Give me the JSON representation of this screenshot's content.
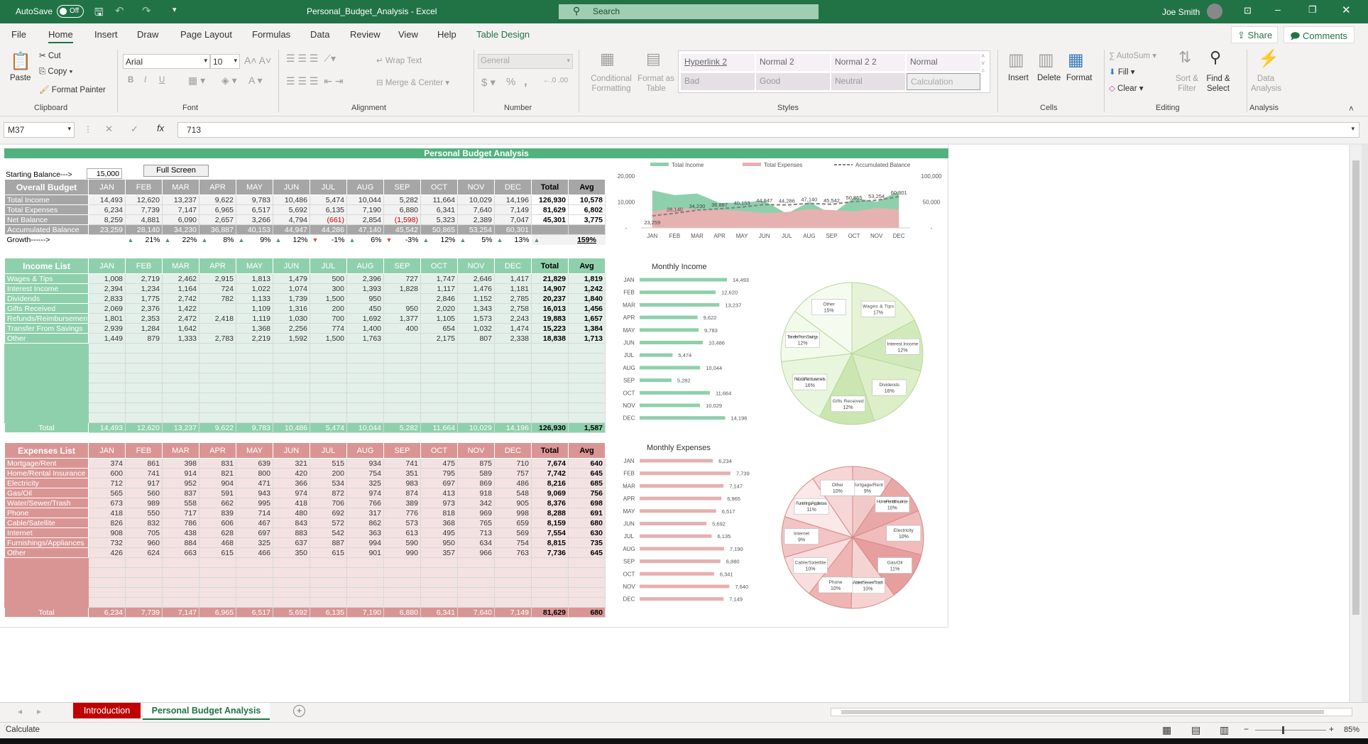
{
  "titlebar": {
    "autosave": "AutoSave",
    "autosave_state": "Off",
    "doc_title": "Personal_Budget_Analysis  -  Excel",
    "search_placeholder": "Search",
    "user": "Joe Smith"
  },
  "menu": {
    "tabs": [
      "File",
      "Home",
      "Insert",
      "Draw",
      "Page Layout",
      "Formulas",
      "Data",
      "Review",
      "View",
      "Help",
      "Table Design"
    ],
    "share": "Share",
    "comments": "Comments"
  },
  "ribbon": {
    "clipboard": {
      "paste": "Paste",
      "cut": "Cut",
      "copy": "Copy",
      "format_painter": "Format Painter",
      "group": "Clipboard"
    },
    "font": {
      "name": "Arial",
      "size": "10",
      "bold": "B",
      "italic": "I",
      "underline": "U",
      "group": "Font"
    },
    "alignment": {
      "wrap": "Wrap Text",
      "merge": "Merge & Center",
      "group": "Alignment"
    },
    "number": {
      "format": "General",
      "currency": "$",
      "percent": "%",
      "comma": ",",
      "group": "Number"
    },
    "styles": {
      "conditional": "Conditional Formatting",
      "format_table": "Format as Table",
      "cells": [
        "Hyperlink 2",
        "Normal 2",
        "Normal 2 2",
        "Normal",
        "Bad",
        "Good",
        "Neutral",
        "Calculation"
      ],
      "group": "Styles"
    },
    "cells": {
      "insert": "Insert",
      "delete": "Delete",
      "format": "Format",
      "group": "Cells"
    },
    "editing": {
      "autosum": "AutoSum",
      "fill": "Fill",
      "clear": "Clear",
      "sort": "Sort & Filter",
      "find": "Find & Select",
      "group": "Editing"
    },
    "analysis": {
      "data_analysis": "Data Analysis",
      "group": "Analysis"
    }
  },
  "formula_bar": {
    "name_box": "M37",
    "fx": "fx",
    "value": "713"
  },
  "sheet": {
    "banner": "Personal Budget Analysis",
    "starting_balance_label": "Starting Balance--->",
    "starting_balance": "15,000",
    "full_screen": "Full Screen",
    "months": [
      "JAN",
      "FEB",
      "MAR",
      "APR",
      "MAY",
      "JUN",
      "JUL",
      "AUG",
      "SEP",
      "OCT",
      "NOV",
      "DEC"
    ],
    "total_header": "Total",
    "avg_header": "Avg",
    "overall": {
      "title": "Overall Budget",
      "rows": [
        {
          "label": "Total Income",
          "values": [
            "14,493",
            "12,620",
            "13,237",
            "9,622",
            "9,783",
            "10,486",
            "5,474",
            "10,044",
            "5,282",
            "11,664",
            "10,029",
            "14,196"
          ],
          "total": "126,930",
          "avg": "10,578"
        },
        {
          "label": "Total Expenses",
          "values": [
            "6,234",
            "7,739",
            "7,147",
            "6,965",
            "6,517",
            "5,692",
            "6,135",
            "7,190",
            "6,880",
            "6,341",
            "7,640",
            "7,149"
          ],
          "total": "81,629",
          "avg": "6,802"
        },
        {
          "label": "Net Balance",
          "values": [
            "8,259",
            "4,881",
            "6,090",
            "2,657",
            "3,266",
            "4,794",
            "(661)",
            "2,854",
            "(1,598)",
            "5,323",
            "2,389",
            "7,047"
          ],
          "total": "45,301",
          "avg": "3,775"
        }
      ],
      "accumulated": {
        "label": "Accumulated Balance",
        "values": [
          "23,259",
          "28,140",
          "34,230",
          "36,887",
          "40,153",
          "44,947",
          "44,286",
          "47,140",
          "45,542",
          "50,865",
          "53,254",
          "60,301"
        ]
      },
      "growth": {
        "label": "Growth------>",
        "values": [
          "",
          "21%",
          "22%",
          "8%",
          "9%",
          "12%",
          "-1%",
          "6%",
          "-3%",
          "12%",
          "5%",
          "13%"
        ],
        "directions": [
          "",
          "up",
          "up",
          "up",
          "up",
          "up",
          "down",
          "up",
          "down",
          "up",
          "up",
          "up"
        ],
        "total_direction": "up",
        "total": "159%"
      }
    },
    "income": {
      "title": "Income List",
      "rows": [
        {
          "label": "Wages & Tips",
          "values": [
            "1,008",
            "2,719",
            "2,462",
            "2,915",
            "1,813",
            "1,479",
            "500",
            "2,396",
            "727",
            "1,747",
            "2,646",
            "1,417"
          ],
          "total": "21,829",
          "avg": "1,819"
        },
        {
          "label": "Interest Income",
          "values": [
            "2,394",
            "1,234",
            "1,164",
            "724",
            "1,022",
            "1,074",
            "300",
            "1,393",
            "1,828",
            "1,117",
            "1,476",
            "1,181"
          ],
          "total": "14,907",
          "avg": "1,242"
        },
        {
          "label": "Dividends",
          "values": [
            "2,833",
            "1,775",
            "2,742",
            "782",
            "1,133",
            "1,739",
            "1,500",
            "950",
            "",
            "2,846",
            "1,152",
            "2,785"
          ],
          "total": "20,237",
          "avg": "1,840"
        },
        {
          "label": "Gifts Received",
          "values": [
            "2,069",
            "2,376",
            "1,422",
            "",
            "1,109",
            "1,316",
            "200",
            "450",
            "950",
            "2,020",
            "1,343",
            "2,758"
          ],
          "total": "16,013",
          "avg": "1,456"
        },
        {
          "label": "Refunds/Reimbursements",
          "values": [
            "1,801",
            "2,353",
            "2,472",
            "2,418",
            "1,119",
            "1,030",
            "700",
            "1,692",
            "1,377",
            "1,105",
            "1,573",
            "2,243"
          ],
          "total": "19,883",
          "avg": "1,657"
        },
        {
          "label": "Transfer From Savings",
          "values": [
            "2,939",
            "1,284",
            "1,642",
            "",
            "1,368",
            "2,256",
            "774",
            "1,400",
            "400",
            "654",
            "1,032",
            "1,474"
          ],
          "total": "15,223",
          "avg": "1,384"
        },
        {
          "label": "Other",
          "values": [
            "1,449",
            "879",
            "1,333",
            "2,783",
            "2,219",
            "1,592",
            "1,500",
            "1,763",
            "",
            "2,175",
            "807",
            "2,338"
          ],
          "total": "18,838",
          "avg": "1,713"
        }
      ],
      "total": {
        "label": "Total",
        "values": [
          "14,493",
          "12,620",
          "13,237",
          "9,622",
          "9,783",
          "10,486",
          "5,474",
          "10,044",
          "5,282",
          "11,664",
          "10,029",
          "14,196"
        ],
        "total": "126,930",
        "avg": "1,587"
      }
    },
    "expenses": {
      "title": "Expenses List",
      "rows": [
        {
          "label": "Mortgage/Rent",
          "values": [
            "374",
            "861",
            "398",
            "831",
            "639",
            "321",
            "515",
            "934",
            "741",
            "475",
            "875",
            "710"
          ],
          "total": "7,674",
          "avg": "640"
        },
        {
          "label": "Home/Rental Insurance",
          "values": [
            "600",
            "741",
            "914",
            "821",
            "800",
            "420",
            "200",
            "754",
            "351",
            "795",
            "589",
            "757"
          ],
          "total": "7,742",
          "avg": "645"
        },
        {
          "label": "Electricity",
          "values": [
            "712",
            "917",
            "952",
            "904",
            "471",
            "366",
            "534",
            "325",
            "983",
            "697",
            "869",
            "486"
          ],
          "total": "8,216",
          "avg": "685"
        },
        {
          "label": "Gas/Oil",
          "values": [
            "565",
            "560",
            "837",
            "591",
            "943",
            "974",
            "872",
            "974",
            "874",
            "413",
            "918",
            "548"
          ],
          "total": "9,069",
          "avg": "756"
        },
        {
          "label": "Water/Sewer/Trash",
          "values": [
            "673",
            "989",
            "558",
            "662",
            "995",
            "418",
            "706",
            "766",
            "389",
            "973",
            "342",
            "905"
          ],
          "total": "8,376",
          "avg": "698"
        },
        {
          "label": "Phone",
          "values": [
            "418",
            "550",
            "717",
            "839",
            "714",
            "480",
            "692",
            "317",
            "776",
            "818",
            "969",
            "998"
          ],
          "total": "8,288",
          "avg": "691"
        },
        {
          "label": "Cable/Satellite",
          "values": [
            "826",
            "832",
            "786",
            "606",
            "467",
            "843",
            "572",
            "862",
            "573",
            "368",
            "765",
            "659"
          ],
          "total": "8,159",
          "avg": "680"
        },
        {
          "label": "Internet",
          "values": [
            "908",
            "705",
            "438",
            "628",
            "697",
            "883",
            "542",
            "363",
            "613",
            "495",
            "713",
            "569"
          ],
          "total": "7,554",
          "avg": "630"
        },
        {
          "label": "Furnishings/Appliances",
          "values": [
            "732",
            "960",
            "884",
            "468",
            "325",
            "637",
            "887",
            "994",
            "590",
            "950",
            "634",
            "754"
          ],
          "total": "8,815",
          "avg": "735"
        },
        {
          "label": "Other",
          "values": [
            "426",
            "624",
            "663",
            "615",
            "466",
            "350",
            "615",
            "901",
            "990",
            "357",
            "966",
            "763"
          ],
          "total": "7,736",
          "avg": "645"
        }
      ],
      "total": {
        "label": "Total",
        "values": [
          "6,234",
          "7,739",
          "7,147",
          "6,965",
          "6,517",
          "5,692",
          "6,135",
          "7,190",
          "6,880",
          "6,341",
          "7,640",
          "7,149"
        ],
        "total": "81,629",
        "avg": "680"
      }
    }
  },
  "chart_data": [
    {
      "type": "area",
      "categories": [
        "JAN",
        "FEB",
        "MAR",
        "APR",
        "MAY",
        "JUN",
        "JUL",
        "AUG",
        "SEP",
        "OCT",
        "NOV",
        "DEC"
      ],
      "series": [
        {
          "name": "Total Income",
          "axis": "left",
          "color": "#8fd0ac",
          "values": [
            14493,
            12620,
            13237,
            9622,
            9783,
            10486,
            5474,
            10044,
            5282,
            11664,
            10029,
            14196
          ]
        },
        {
          "name": "Total Expenses",
          "axis": "left",
          "color": "#e6b1b1",
          "values": [
            6234,
            7739,
            7147,
            6965,
            6517,
            5692,
            6135,
            7190,
            6880,
            6341,
            7640,
            7149
          ]
        },
        {
          "name": "Accumulated Balance",
          "axis": "right",
          "line": "dashed",
          "color": "#808080",
          "values": [
            23259,
            28140,
            34230,
            36887,
            40153,
            44947,
            44286,
            47140,
            45542,
            50865,
            53254,
            60301
          ],
          "data_labels": [
            "23,259",
            "28,140",
            "34,230",
            "36,887",
            "40,153",
            "44,947",
            "44,286",
            "47,140",
            "45,542",
            "50,865",
            "53,254",
            "60,301"
          ]
        }
      ],
      "ylim_left": [
        0,
        20000
      ],
      "ylim_right": [
        0,
        100000
      ],
      "left_ticks": [
        "-",
        "10,000",
        "20,000"
      ],
      "right_ticks": [
        "-",
        "50,000",
        "100,000"
      ],
      "legend": "top"
    },
    {
      "type": "bar",
      "orientation": "horizontal",
      "title": "Monthly Income",
      "color": "#8fd0ac",
      "categories": [
        "JAN",
        "FEB",
        "MAR",
        "APR",
        "MAY",
        "JUN",
        "JUL",
        "AUG",
        "SEP",
        "OCT",
        "NOV",
        "DEC"
      ],
      "values": [
        14493,
        12620,
        13237,
        9622,
        9783,
        10486,
        5474,
        10044,
        5282,
        11664,
        10029,
        14196
      ],
      "labels": [
        "14,493",
        "12,620",
        "13,237",
        "9,622",
        "9,783",
        "10,486",
        "5,474",
        "10,044",
        "5,282",
        "11,664",
        "10,029",
        "14,196"
      ]
    },
    {
      "type": "pie",
      "categories": [
        "Wages & Tips",
        "Interest Income",
        "Dividends",
        "Gifts Received",
        "Refunds/Reimbursements",
        "Transfer From Savings",
        "Other"
      ],
      "values": [
        21829,
        14907,
        20237,
        16013,
        19883,
        15223,
        18838
      ],
      "percent_labels": [
        "17%",
        "12%",
        "16%",
        "12%",
        "16%",
        "12%",
        "15%"
      ]
    },
    {
      "type": "bar",
      "orientation": "horizontal",
      "title": "Monthly Expenses",
      "color": "#e6b1b1",
      "categories": [
        "JAN",
        "FEB",
        "MAR",
        "APR",
        "MAY",
        "JUN",
        "JUL",
        "AUG",
        "SEP",
        "OCT",
        "NOV",
        "DEC"
      ],
      "values": [
        6234,
        7739,
        7147,
        6965,
        6517,
        5692,
        6135,
        7190,
        6880,
        6341,
        7640,
        7149
      ],
      "labels": [
        "6,234",
        "7,739",
        "7,147",
        "6,965",
        "6,517",
        "5,692",
        "6,135",
        "7,190",
        "6,880",
        "6,341",
        "7,640",
        "7,149"
      ]
    },
    {
      "type": "pie",
      "categories": [
        "Mortgage/Rent",
        "Home/Rental Insurance",
        "Electricity",
        "Gas/Oil",
        "Water/Sewer/Trash",
        "Phone",
        "Cable/Satellite",
        "Internet",
        "Furnishings/Appliances",
        "Other"
      ],
      "values": [
        7674,
        7742,
        8216,
        9069,
        8376,
        8288,
        8159,
        7554,
        8815,
        7736
      ],
      "percent_labels": [
        "9%",
        "10%",
        "10%",
        "11%",
        "10%",
        "10%",
        "10%",
        "9%",
        "11%",
        "10%"
      ]
    }
  ],
  "sheet_tabs": {
    "sheets": [
      "Introduction",
      "Personal Budget Analysis"
    ],
    "add": "+"
  },
  "status": {
    "mode": "Calculate",
    "zoom": "85%"
  }
}
